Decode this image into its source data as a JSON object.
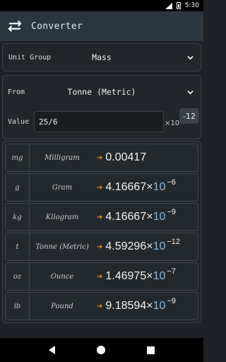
{
  "status": {
    "time": "5:30"
  },
  "app": {
    "title": "Converter"
  },
  "unit_group": {
    "label": "Unit Group",
    "value": "Mass"
  },
  "from": {
    "label": "From",
    "value": "Tonne (Metric)"
  },
  "value": {
    "label": "Value",
    "input": "25/6",
    "times": "×10",
    "exponent": "-12"
  },
  "results": [
    {
      "symbol": "mg",
      "name": "Milligram",
      "arrow": "➔",
      "mantissa": "0.00417",
      "base": "",
      "exponent": ""
    },
    {
      "symbol": "g",
      "name": "Gram",
      "arrow": "➔",
      "mantissa": "4.16667×",
      "base": "10",
      "exponent": "−6"
    },
    {
      "symbol": "kg",
      "name": "Kilogram",
      "arrow": "➔",
      "mantissa": "4.16667×",
      "base": "10",
      "exponent": "−9"
    },
    {
      "symbol": "t",
      "name": "Tonne (Metric)",
      "arrow": "➔",
      "mantissa": "4.59296×",
      "base": "10",
      "exponent": "−12"
    },
    {
      "symbol": "oz",
      "name": "Ounce",
      "arrow": "➔",
      "mantissa": "1.46975×",
      "base": "10",
      "exponent": "−7"
    },
    {
      "symbol": "ib",
      "name": "Pound",
      "arrow": "➔",
      "mantissa": "9.18594×",
      "base": "10",
      "exponent": "−9"
    }
  ],
  "icons": {
    "swap": "swap-arrows-icon",
    "chevron": "chevron-down-icon"
  },
  "colors": {
    "appbar": "#2b3640",
    "accent_arrow": "#e08a2c",
    "background": "#1e2226"
  }
}
